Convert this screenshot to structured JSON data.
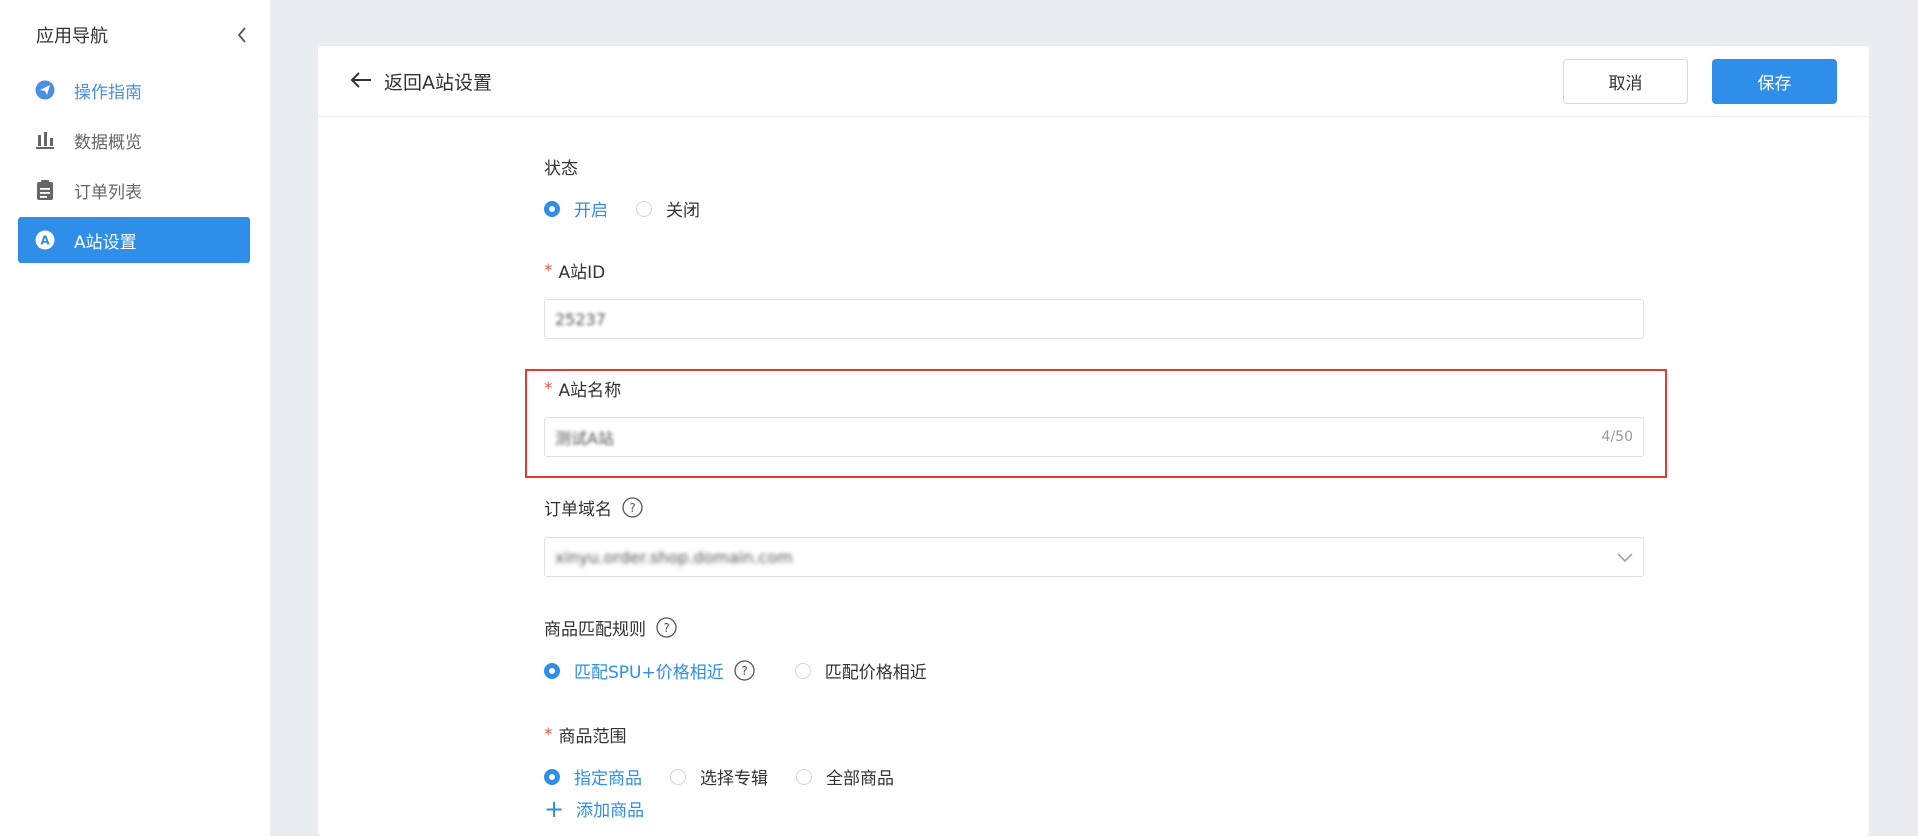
{
  "sidebar": {
    "title": "应用导航",
    "items": [
      {
        "label": "操作指南",
        "icon": "paper-plane-icon"
      },
      {
        "label": "数据概览",
        "icon": "bar-chart-icon"
      },
      {
        "label": "订单列表",
        "icon": "clipboard-icon"
      },
      {
        "label": "A站设置",
        "icon": "site-a-icon"
      }
    ]
  },
  "header": {
    "back_label": "返回A站设置",
    "cancel_label": "取消",
    "save_label": "保存"
  },
  "form": {
    "status": {
      "label": "状态",
      "options": [
        {
          "label": "开启",
          "selected": true
        },
        {
          "label": "关闭",
          "selected": false
        }
      ]
    },
    "site_id": {
      "required_mark": "*",
      "label": "A站ID",
      "value": "25237"
    },
    "site_name": {
      "required_mark": "*",
      "label": "A站名称",
      "value": "测试A站",
      "counter": "4/50"
    },
    "order_domain": {
      "label": "订单域名",
      "value": "xinyu.order.shop.domain.com"
    },
    "match_rule": {
      "label": "商品匹配规则",
      "options": [
        {
          "label": "匹配SPU+价格相近",
          "selected": true
        },
        {
          "label": "匹配价格相近",
          "selected": false
        }
      ]
    },
    "product_scope": {
      "required_mark": "*",
      "label": "商品范围",
      "options": [
        {
          "label": "指定商品",
          "selected": true
        },
        {
          "label": "选择专辑",
          "selected": false
        },
        {
          "label": "全部商品",
          "selected": false
        }
      ],
      "add_label": "添加商品"
    }
  },
  "colors": {
    "accent": "#2f8ee8",
    "required": "#f0564f",
    "highlight": "#e53935"
  }
}
